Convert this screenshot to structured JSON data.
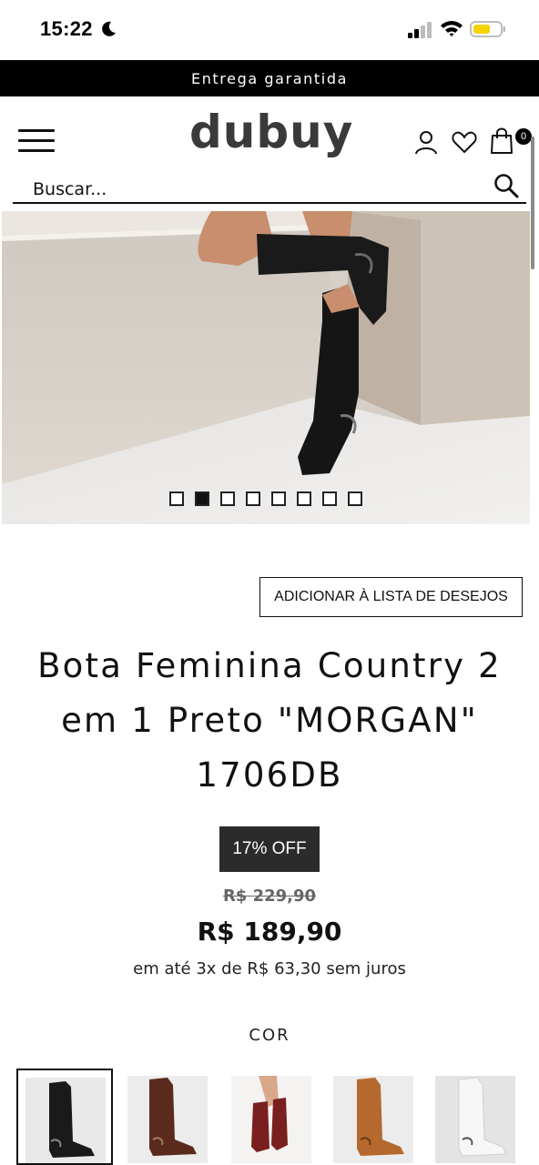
{
  "status_bar": {
    "time": "15:22",
    "icons": [
      "moon-icon",
      "signal-icon",
      "wifi-icon",
      "battery-icon"
    ]
  },
  "promo": {
    "text": "Entrega garantida"
  },
  "header": {
    "logo": "dubuy",
    "cart_count": "0",
    "icons": [
      "menu-icon",
      "user-icon",
      "heart-icon",
      "bag-icon"
    ]
  },
  "search": {
    "placeholder": "Buscar..."
  },
  "gallery": {
    "total_images": 8,
    "active_index": 1
  },
  "product": {
    "wishlist_label": "ADICIONAR À LISTA DE DESEJOS",
    "title": "Bota Feminina Country 2 em 1 Preto \"MORGAN\" 1706DB",
    "discount": "17% OFF",
    "old_price": "R$ 229,90",
    "price": "R$ 189,90",
    "installments": "em até 3x de R$ 63,30 sem juros",
    "color_label": "COR"
  },
  "colors": {
    "accent": "#000000",
    "badge": "#2b2b2b",
    "swatches": [
      "#1a1a1a",
      "#5a2a1c",
      "#7a1f1f",
      "#b5692e",
      "#f2f2f2"
    ]
  }
}
